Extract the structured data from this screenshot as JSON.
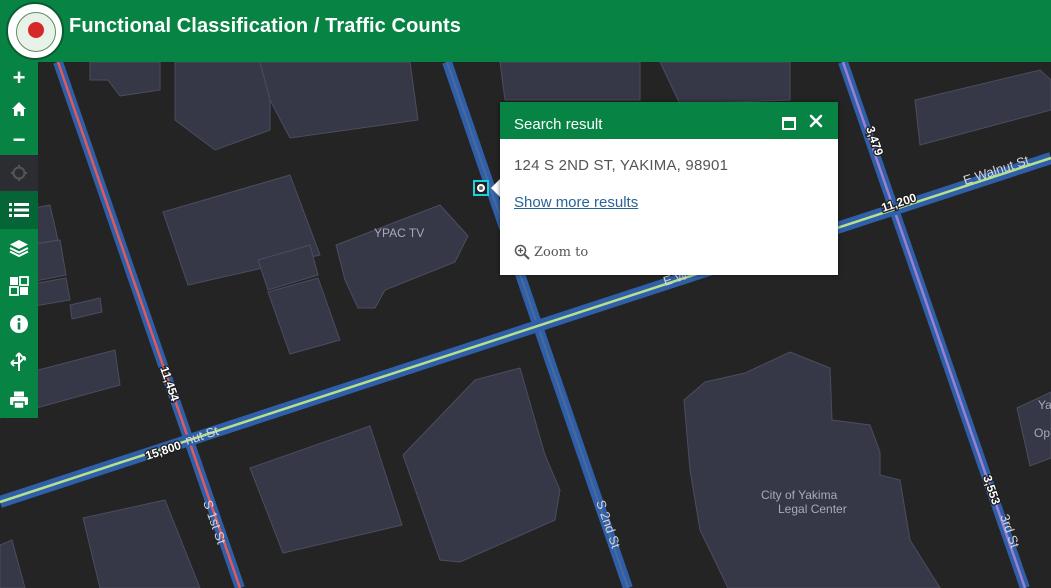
{
  "app": {
    "title": "Functional Classification / Traffic Counts"
  },
  "toolbar": {
    "zoom_in": "+",
    "zoom_out": "−"
  },
  "map": {
    "buildings": {
      "ypac": "YPAC TV",
      "legal_center": [
        "City of Yakima",
        "Legal Center"
      ],
      "partial_right": [
        "Ya",
        "Op"
      ]
    },
    "streets": {
      "s_1st": "S 1st St",
      "s_2nd": "S 2nd St",
      "s_3rd": "3rd St",
      "e_walnut": "E Walnut St",
      "e_walnut_partial": "E W",
      "walnut_partial": "nut St"
    },
    "traffic_counts": {
      "s_1st": "11,454",
      "walnut_west": "15,800",
      "walnut_east": "11,200",
      "s_3rd_north": "3,479",
      "s_3rd_south": "3,553"
    },
    "colors": {
      "header": "#078344",
      "road_blue": "#2f5fa8",
      "road_red": "#e05a5a",
      "road_green": "#b6e08a",
      "road_purple": "#9b7fd0",
      "building": "#363847"
    }
  },
  "popup": {
    "title": "Search result",
    "address": "124 S 2ND ST, YAKIMA, 98901",
    "more_link": "Show more results",
    "zoom_to": "Zoom to"
  }
}
